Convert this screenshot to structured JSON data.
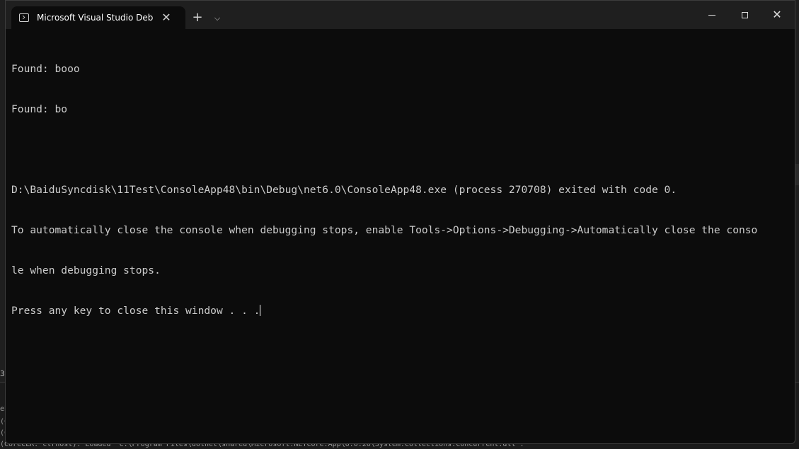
{
  "window": {
    "tab_title": "Microsoft Visual Studio Debug Console",
    "tab_close": "✕",
    "new_tab": "+",
    "dropdown": "⌵",
    "close_glyph": "✕"
  },
  "console": {
    "lines": [
      "Found: booo",
      "Found: bo",
      "",
      "D:\\BaiduSyncdisk\\11Test\\ConsoleApp48\\bin\\Debug\\net6.0\\ConsoleApp48.exe (process 270708) exited with code 0.",
      "To automatically close the console when debugging stops, enable Tools->Options->Debugging->Automatically close the conso",
      "le when debugging stops.",
      "Press any key to close this window . . ."
    ]
  },
  "background": {
    "left_number": "3",
    "output_lines": [
      "eb",
      "(C",
      "(C",
      "(CoreCLR: clrhost): Loaded 'C:\\Program Files\\dotnet\\shared\\Microsoft.NETCore.App\\6.0.26\\System.Collections.Concurrent.dll'."
    ]
  }
}
